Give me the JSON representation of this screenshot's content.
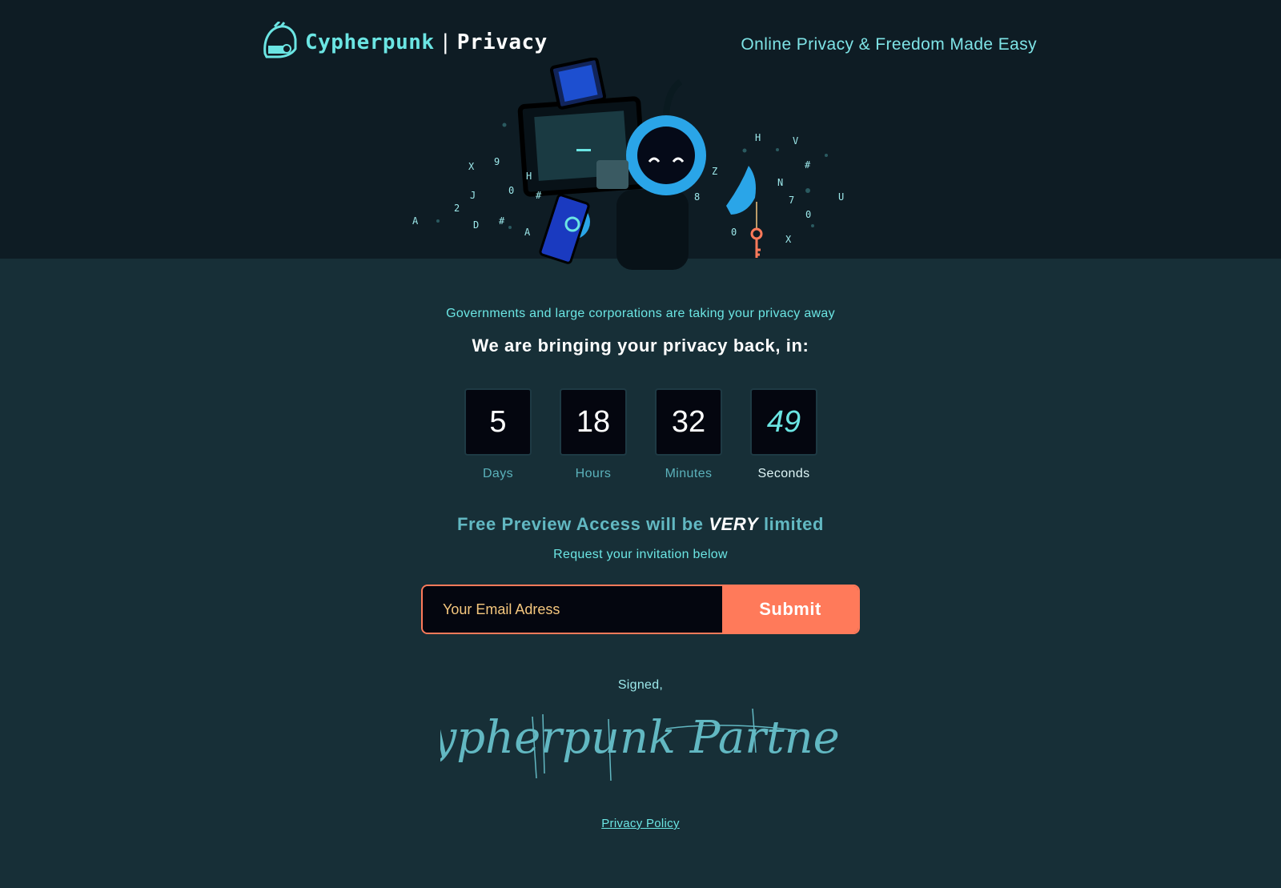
{
  "header": {
    "brand": "Cypherpunk",
    "separator": "|",
    "sub": "Privacy",
    "tagline": "Online Privacy & Freedom Made Easy"
  },
  "main": {
    "intro": "Governments and large corporations are taking your privacy away",
    "headline": "We are bringing your privacy back, in:",
    "countdown": [
      {
        "value": "5",
        "label": "Days"
      },
      {
        "value": "18",
        "label": "Hours"
      },
      {
        "value": "32",
        "label": "Minutes"
      },
      {
        "value": "49",
        "label": "Seconds"
      }
    ],
    "promo_before": "Free Preview Access will be ",
    "promo_emphasis": "VERY",
    "promo_after": " limited",
    "request": "Request your invitation below"
  },
  "form": {
    "email_placeholder": "Your Email Adress",
    "submit_label": "Submit"
  },
  "footer": {
    "signed": "Signed,",
    "signature": "Cypherpunk Partners",
    "privacy_link": "Privacy Policy"
  },
  "illustration": {
    "glyphs": [
      "X",
      "9",
      "J",
      "2",
      "A",
      "D",
      "#",
      "0",
      "H",
      "#",
      "A",
      "H",
      "V",
      "#",
      "Z",
      "N",
      "7",
      "U",
      "0",
      "8",
      "0",
      "X"
    ]
  },
  "colors": {
    "hero_bg": "#0e1c24",
    "page_bg": "#172f37",
    "accent": "#6be5e3",
    "submit": "#ff7a5a"
  }
}
